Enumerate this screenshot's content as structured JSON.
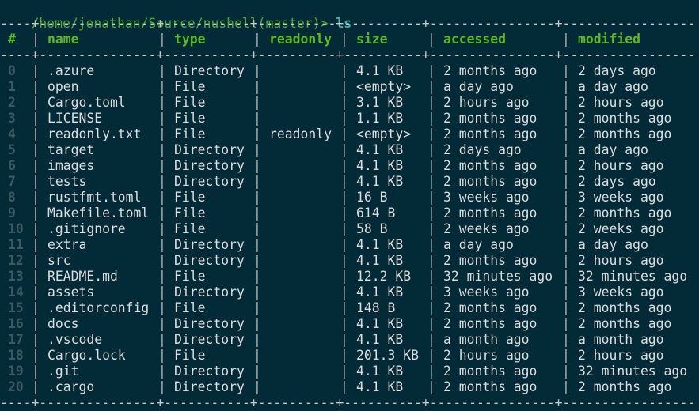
{
  "prompt": {
    "path": "/home/jonathan/Source/nushell(master)> ",
    "command": "ls"
  },
  "colors": {
    "background": "#022b37",
    "prompt_path": "#4ea82a",
    "prompt_command": "#36b5a8",
    "header": "#5cb91f",
    "index": "#3c5a62",
    "text": "#dcdcdc"
  },
  "table": {
    "columns": [
      "#",
      "name",
      "type",
      "readonly",
      "size",
      "accessed",
      "modified"
    ],
    "rows": [
      {
        "index": "0",
        "name": ".azure",
        "type": "Directory",
        "readonly": "",
        "size": "4.1 KB",
        "accessed": "2 months ago",
        "modified": "2 days ago"
      },
      {
        "index": "1",
        "name": "open",
        "type": "File",
        "readonly": "",
        "size": "<empty>",
        "accessed": "a day ago",
        "modified": "a day ago"
      },
      {
        "index": "2",
        "name": "Cargo.toml",
        "type": "File",
        "readonly": "",
        "size": "3.1 KB",
        "accessed": "2 hours ago",
        "modified": "2 hours ago"
      },
      {
        "index": "3",
        "name": "LICENSE",
        "type": "File",
        "readonly": "",
        "size": "1.1 KB",
        "accessed": "2 months ago",
        "modified": "2 months ago"
      },
      {
        "index": "4",
        "name": "readonly.txt",
        "type": "File",
        "readonly": "readonly",
        "size": "<empty>",
        "accessed": "2 months ago",
        "modified": "2 months ago"
      },
      {
        "index": "5",
        "name": "target",
        "type": "Directory",
        "readonly": "",
        "size": "4.1 KB",
        "accessed": "2 days ago",
        "modified": "a day ago"
      },
      {
        "index": "6",
        "name": "images",
        "type": "Directory",
        "readonly": "",
        "size": "4.1 KB",
        "accessed": "2 months ago",
        "modified": "2 hours ago"
      },
      {
        "index": "7",
        "name": "tests",
        "type": "Directory",
        "readonly": "",
        "size": "4.1 KB",
        "accessed": "2 months ago",
        "modified": "2 days ago"
      },
      {
        "index": "8",
        "name": "rustfmt.toml",
        "type": "File",
        "readonly": "",
        "size": "16 B",
        "accessed": "3 weeks ago",
        "modified": "3 weeks ago"
      },
      {
        "index": "9",
        "name": "Makefile.toml",
        "type": "File",
        "readonly": "",
        "size": "614 B",
        "accessed": "2 months ago",
        "modified": "2 months ago"
      },
      {
        "index": "10",
        "name": ".gitignore",
        "type": "File",
        "readonly": "",
        "size": "58 B",
        "accessed": "2 weeks ago",
        "modified": "2 weeks ago"
      },
      {
        "index": "11",
        "name": "extra",
        "type": "Directory",
        "readonly": "",
        "size": "4.1 KB",
        "accessed": "a day ago",
        "modified": "a day ago"
      },
      {
        "index": "12",
        "name": "src",
        "type": "Directory",
        "readonly": "",
        "size": "4.1 KB",
        "accessed": "2 months ago",
        "modified": "2 hours ago"
      },
      {
        "index": "13",
        "name": "README.md",
        "type": "File",
        "readonly": "",
        "size": "12.2 KB",
        "accessed": "32 minutes ago",
        "modified": "32 minutes ago"
      },
      {
        "index": "14",
        "name": "assets",
        "type": "Directory",
        "readonly": "",
        "size": "4.1 KB",
        "accessed": "3 weeks ago",
        "modified": "3 weeks ago"
      },
      {
        "index": "15",
        "name": ".editorconfig",
        "type": "File",
        "readonly": "",
        "size": "148 B",
        "accessed": "2 months ago",
        "modified": "2 months ago"
      },
      {
        "index": "16",
        "name": "docs",
        "type": "Directory",
        "readonly": "",
        "size": "4.1 KB",
        "accessed": "2 months ago",
        "modified": "2 months ago"
      },
      {
        "index": "17",
        "name": ".vscode",
        "type": "Directory",
        "readonly": "",
        "size": "4.1 KB",
        "accessed": "a month ago",
        "modified": "a month ago"
      },
      {
        "index": "18",
        "name": "Cargo.lock",
        "type": "File",
        "readonly": "",
        "size": "201.3 KB",
        "accessed": "2 hours ago",
        "modified": "2 hours ago"
      },
      {
        "index": "19",
        "name": ".git",
        "type": "Directory",
        "readonly": "",
        "size": "4.1 KB",
        "accessed": "2 months ago",
        "modified": "32 minutes ago"
      },
      {
        "index": "20",
        "name": ".cargo",
        "type": "Directory",
        "readonly": "",
        "size": "4.1 KB",
        "accessed": "2 months ago",
        "modified": "2 months ago"
      }
    ]
  }
}
